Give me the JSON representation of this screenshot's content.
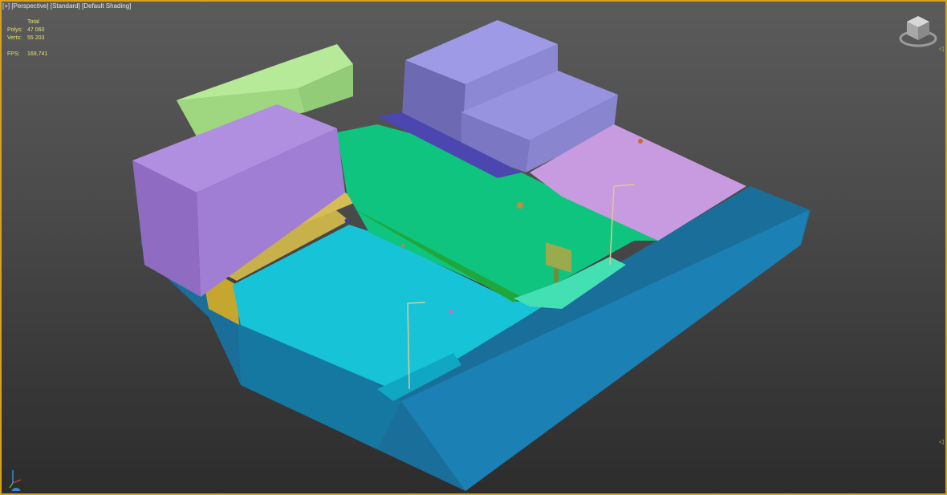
{
  "viewport": {
    "plus": "[+]",
    "view": "[Perspective]",
    "style": "[Standard]",
    "shading": "[Default Shading]"
  },
  "stats": {
    "header": "Total",
    "polys_label": "Polys:",
    "polys_value": "47 060",
    "verts_label": "Verts:",
    "verts_value": "55 203",
    "fps_label": "FPS:",
    "fps_value": "169,741"
  },
  "icons": {
    "viewcube": "viewcube-icon",
    "axis": "axis-tripod-icon",
    "bracket_top": "viewport-bracket-top-icon",
    "bracket_bottom": "viewport-bracket-bottom-icon"
  },
  "colors": {
    "border_active": "#d4a21c",
    "base_blue": "#1b7fb0",
    "plaza_cyan": "#14c3d6",
    "lawn_green": "#0fc884",
    "building_violet": "#a485d8",
    "building_periwinkle": "#8b86cf",
    "building_lightgreen": "#aee38f",
    "yellow_sidewalk": "#c9b24d",
    "pink_lot": "#c99ce0"
  }
}
